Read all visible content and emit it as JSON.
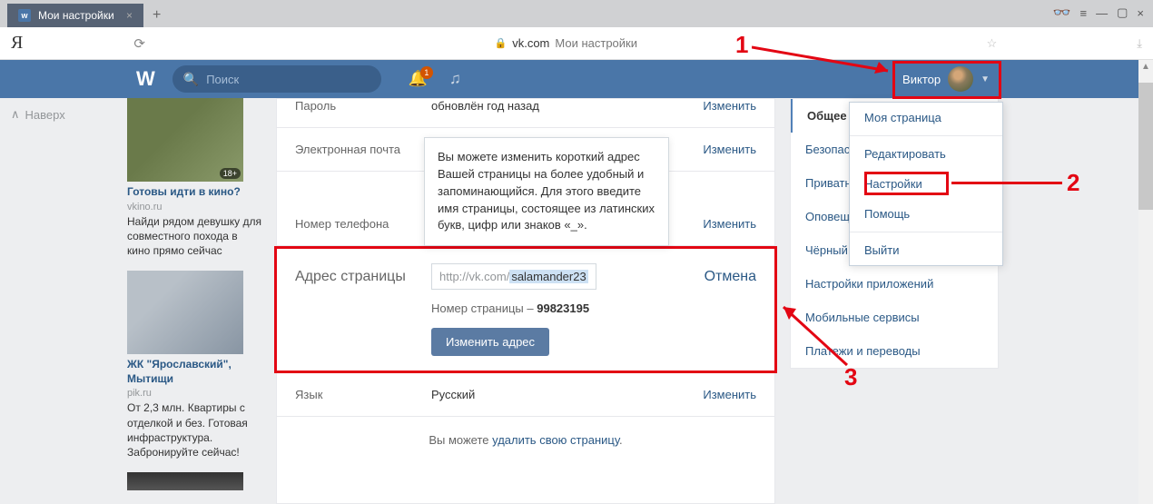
{
  "browser": {
    "tab_title": "Мои настройки",
    "url_domain": "vk.com",
    "url_path": "Мои настройки"
  },
  "annotations": {
    "one": "1",
    "two": "2",
    "three": "3"
  },
  "topnav": {
    "search_placeholder": "Поиск",
    "notif_count": "1",
    "profile_name": "Виктор"
  },
  "leftcol": {
    "up": "Наверх"
  },
  "ads": [
    {
      "title": "Готовы идти в кино?",
      "domain": "vkino.ru",
      "desc": "Найди рядом девушку для совместного похода в кино прямо сейчас",
      "age": "18+"
    },
    {
      "title": "ЖК \"Ярославский\", Мытищи",
      "domain": "pik.ru",
      "desc": "От 2,3 млн. Квартиры с отделкой и без. Готовая инфраструктура. Забронируйте сейчас!",
      "age": ""
    }
  ],
  "settings": {
    "password_label": "Пароль",
    "password_value": "обновлён год назад",
    "change": "Изменить",
    "email_label": "Электронная почта",
    "phone_label": "Номер телефона",
    "tooltip": "Вы можете изменить короткий адрес Вашей страницы на более удобный и запоминающийся. Для этого введите имя страницы, состоящее из латинских букв, цифр или знаков «_».",
    "addr_label": "Адрес страницы",
    "addr_prefix": "http://vk.com/",
    "addr_value": "salamander23",
    "cancel": "Отмена",
    "pagenum_label": "Номер страницы – ",
    "pagenum_value": "99823195",
    "change_addr_btn": "Изменить адрес",
    "lang_label": "Язык",
    "lang_value": "Русский",
    "delete_prefix": "Вы можете ",
    "delete_link": "удалить свою страницу"
  },
  "sidemenu": [
    "Общее",
    "Безопасность",
    "Приватность",
    "Оповещения",
    "Чёрный список",
    "Настройки приложений",
    "Мобильные сервисы",
    "Платежи и переводы"
  ],
  "dropdown": {
    "my_page": "Моя страница",
    "edit": "Редактировать",
    "settings": "Настройки",
    "help": "Помощь",
    "logout": "Выйти"
  }
}
